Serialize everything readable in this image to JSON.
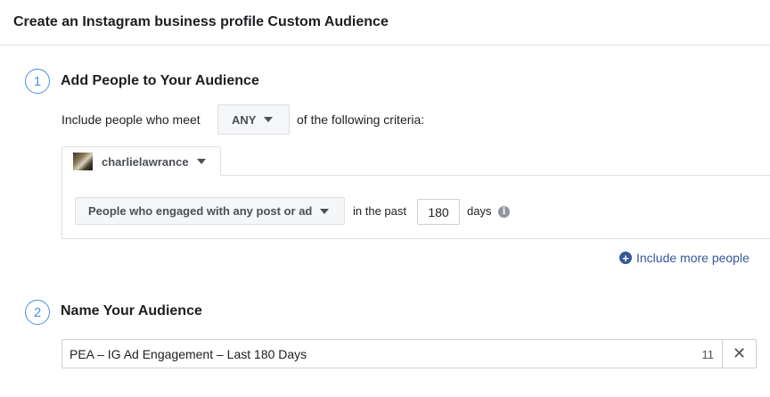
{
  "header": {
    "title": "Create an Instagram business profile Custom Audience"
  },
  "step1": {
    "number": "1",
    "title": "Add People to Your Audience",
    "include_prefix": "Include people who meet",
    "match_dropdown": "ANY",
    "include_suffix": "of the following criteria:",
    "account": {
      "name": "charlielawrance"
    },
    "criteria": {
      "engagement_dropdown": "People who engaged with any post or ad",
      "past_label": "in the past",
      "days_value": "180",
      "days_label": "days"
    },
    "include_more_label": "Include more people"
  },
  "step2": {
    "number": "2",
    "title": "Name Your Audience",
    "name_value": "PEA – IG Ad Engagement – Last 180 Days",
    "char_count": "11"
  },
  "colors": {
    "accent": "#4a90e2",
    "link": "#365899",
    "border": "#dddfe2"
  }
}
